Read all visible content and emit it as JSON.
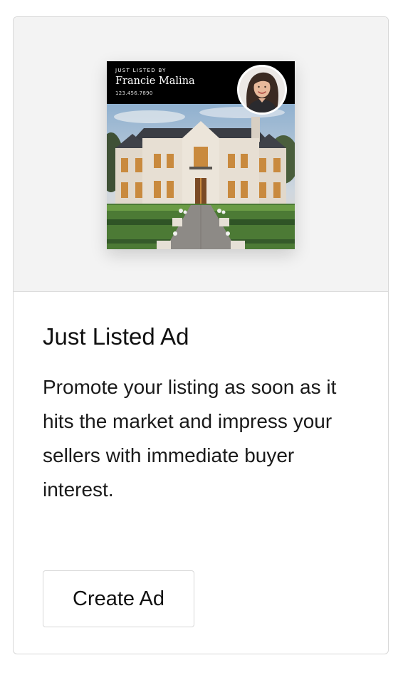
{
  "card": {
    "ad_preview": {
      "kicker": "JUST LISTED BY",
      "agent_name": "Francie Malina",
      "phone": "123.456.7890"
    },
    "title": "Just Listed Ad",
    "description": "Promote your listing as soon as it hits the market and impress your sellers with immediate buyer interest.",
    "cta_label": "Create Ad"
  },
  "colors": {
    "card_border": "#d8d8d8",
    "preview_background": "#f3f3f3",
    "ad_header_background": "#000000",
    "text_primary": "#111111"
  }
}
